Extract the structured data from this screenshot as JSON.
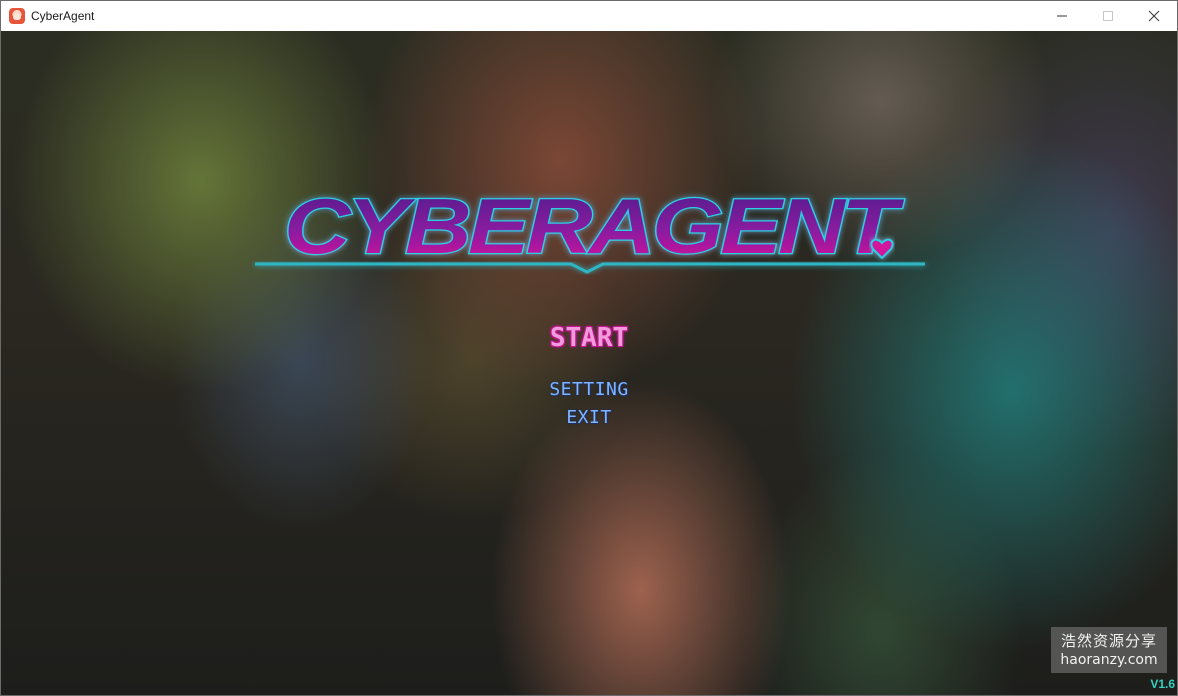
{
  "window": {
    "title": "CyberAgent",
    "icon": "app-character-icon",
    "controls": [
      "minimize-icon",
      "maximize-icon",
      "close-icon"
    ]
  },
  "logo": {
    "text": "CYBERAGENT",
    "heart_icon": "heart-icon",
    "colors": {
      "fill_top": "#5a1f8f",
      "fill_bottom": "#d4169c",
      "outline": "#2ad4e6",
      "underline": "#2fb6c4"
    }
  },
  "menu": {
    "start": "START",
    "setting": "SETTING",
    "exit": "EXIT"
  },
  "watermark": {
    "line1": "浩然资源分享",
    "line2": "haoranzy.com"
  },
  "version": "V1.6"
}
